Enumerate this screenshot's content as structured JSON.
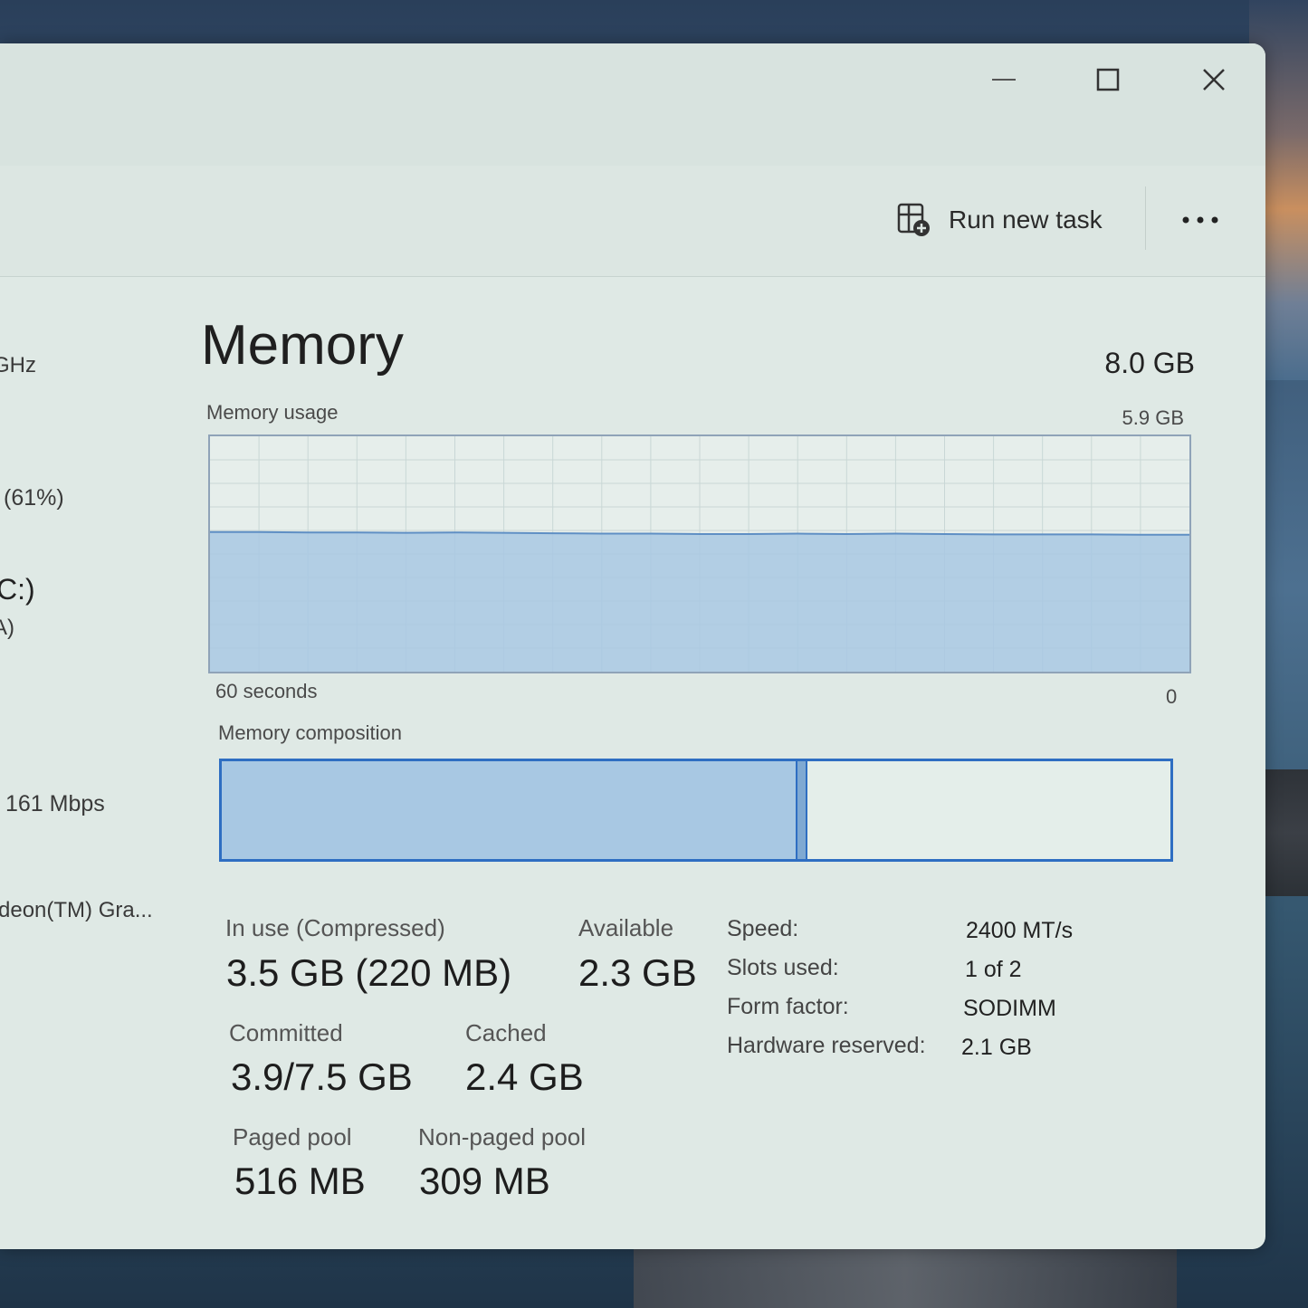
{
  "window_controls": {
    "minimize": "—",
    "maximize": "☐",
    "close": "✕"
  },
  "toolbar": {
    "run_new_task_label": "Run new task",
    "more_label": "..."
  },
  "sidebar": {
    "items": [
      {
        "text": "GHz"
      },
      {
        "text": "(61%)"
      },
      {
        "text": "C:)"
      },
      {
        "text": "A)"
      },
      {
        "text": "161 Mbps"
      },
      {
        "text": "deon(TM) Gra..."
      }
    ]
  },
  "main": {
    "title": "Memory",
    "total": "8.0 GB",
    "usage_label": "Memory usage",
    "usage_max": "5.9 GB",
    "time_label_left": "60 seconds",
    "time_label_right": "0",
    "composition_label": "Memory composition",
    "composition": {
      "in_use_fraction": 0.605,
      "modified_fraction": 0.012
    }
  },
  "chart_data": {
    "type": "area",
    "title": "Memory usage",
    "xlabel": "60 seconds",
    "ylabel": "",
    "ylim": [
      0,
      5.9
    ],
    "x": [
      60,
      57,
      54,
      51,
      48,
      45,
      42,
      39,
      36,
      33,
      30,
      27,
      24,
      21,
      18,
      15,
      12,
      9,
      6,
      3,
      0
    ],
    "series": [
      {
        "values": [
          3.5,
          3.5,
          3.49,
          3.49,
          3.48,
          3.49,
          3.48,
          3.47,
          3.46,
          3.46,
          3.45,
          3.45,
          3.46,
          3.45,
          3.46,
          3.45,
          3.44,
          3.44,
          3.44,
          3.43,
          3.43
        ]
      }
    ],
    "grid": true,
    "color": "#a8c8e3"
  },
  "stats": {
    "in_use_label": "In use (Compressed)",
    "in_use_value": "3.5 GB (220 MB)",
    "available_label": "Available",
    "available_value": "2.3 GB",
    "committed_label": "Committed",
    "committed_value": "3.9/7.5 GB",
    "cached_label": "Cached",
    "cached_value": "2.4 GB",
    "paged_label": "Paged pool",
    "paged_value": "516 MB",
    "nonpaged_label": "Non-paged pool",
    "nonpaged_value": "309 MB"
  },
  "specs": {
    "speed_label": "Speed:",
    "speed_value": "2400 MT/s",
    "slots_label": "Slots used:",
    "slots_value": "1 of 2",
    "form_label": "Form factor:",
    "form_value": "SODIMM",
    "reserved_label": "Hardware reserved:",
    "reserved_value": "2.1 GB"
  }
}
